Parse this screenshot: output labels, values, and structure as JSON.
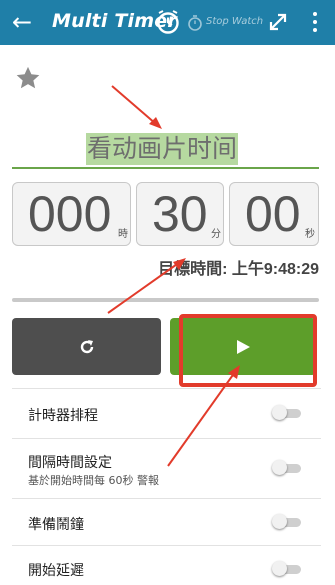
{
  "header": {
    "app_title": "Multi Timer",
    "stopwatch_label": "Stop Watch",
    "back_icon": "arrow-left-icon",
    "background_color": "#1f7fa8"
  },
  "timer": {
    "name": "看动画片时间",
    "hours": "000",
    "hours_unit": "時",
    "minutes": "30",
    "minutes_unit": "分",
    "seconds": "00",
    "seconds_unit": "秒",
    "target_time": "目標時間: 上午9:48:29",
    "progress": 0
  },
  "controls": {
    "reset_icon": "refresh-icon",
    "start_icon": "play-icon",
    "start_color": "#5d9e2a",
    "reset_color": "#4e4e4e"
  },
  "settings": {
    "items": [
      {
        "label": "計時器排程",
        "sub": "",
        "enabled": false
      },
      {
        "label": "間隔時間設定",
        "sub": "基於開始時間每 60秒 警報",
        "enabled": false
      },
      {
        "label": "準備鬧鐘",
        "sub": "",
        "enabled": false
      },
      {
        "label": "開始延遲",
        "sub": "",
        "enabled": false
      }
    ]
  },
  "annotation": {
    "color": "#e23b2b"
  }
}
